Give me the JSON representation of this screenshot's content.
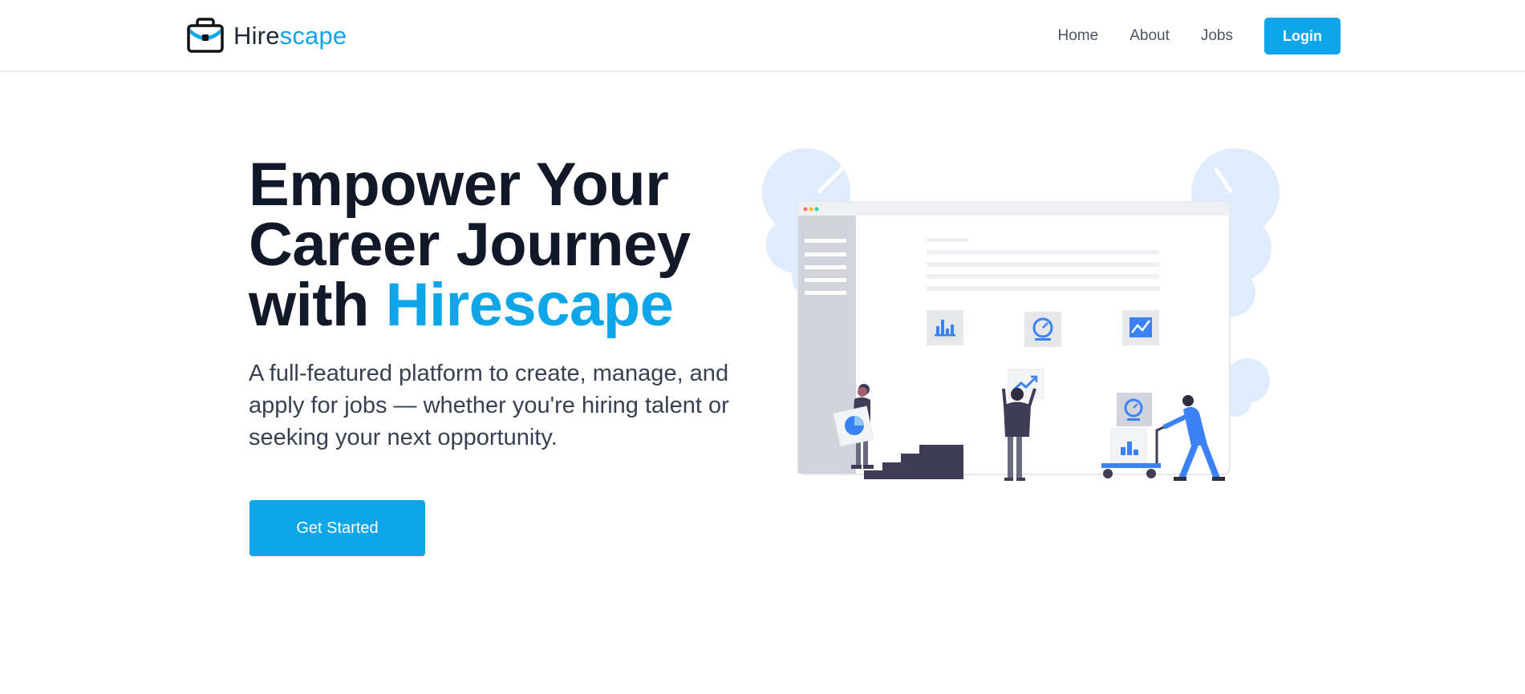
{
  "brand": {
    "name_part1": "Hire",
    "name_part2": "scape"
  },
  "nav": {
    "items": [
      "Home",
      "About",
      "Jobs"
    ],
    "login_label": "Login"
  },
  "hero": {
    "title_line1": "Empower Your",
    "title_line2": "Career Journey",
    "title_line3_prefix": "with ",
    "title_line3_accent": "Hirescape",
    "description": "A full-featured platform to create, manage, and apply for jobs — whether you're hiring talent or seeking your next opportunity.",
    "cta_label": "Get Started"
  },
  "icons": {
    "logo": "briefcase-icon",
    "illustration": "career-illustration",
    "cards": [
      "bar-chart-icon",
      "speedometer-icon",
      "line-chart-icon",
      "trend-chart-icon",
      "pie-chart-icon"
    ]
  },
  "colors": {
    "accent": "#0ea5e9",
    "heading": "#111827",
    "body": "#374151",
    "nav_text": "#4b5563"
  }
}
